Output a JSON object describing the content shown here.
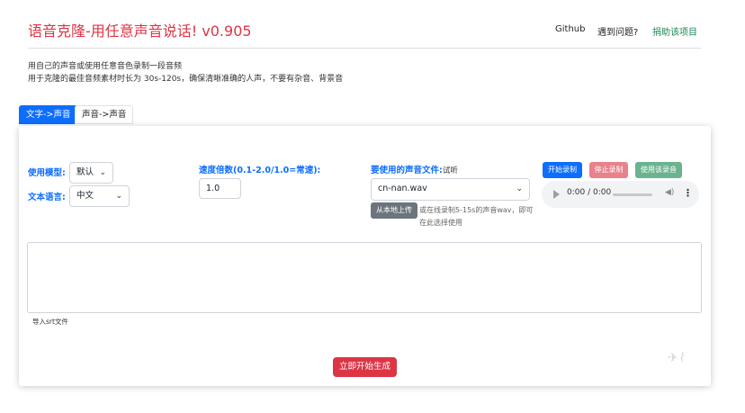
{
  "header": {
    "title": "语音克隆-用任意声音说话! v0.905",
    "nav": {
      "github": "Github",
      "problem": "遇到问题?",
      "donate": "捐助该项目"
    }
  },
  "intro": {
    "line1": "用自己的声音或使用任意音色录制一段音频",
    "line2": "用于克隆的最佳音频素材时长为 30s-120s，确保清晰准确的人声，不要有杂音、背景音"
  },
  "tabs": [
    {
      "label": "文字->声音",
      "active": true
    },
    {
      "label": "声音->声音",
      "active": false
    }
  ],
  "form": {
    "model_label": "使用模型:",
    "model_value": "默认",
    "lang_label": "文本语言:",
    "lang_value": "中文",
    "speed_label": "速度倍数(0.1-2.0/1.0=常速):",
    "speed_value": "1.0",
    "voice_label": "要使用的声音文件:",
    "voice_sub": "试听",
    "voice_value": "cn-nan.wav",
    "upload_label": "从本地上传",
    "upload_hint": "或在线录制5-15s的声音wav，即可在此选择使用",
    "record_start": "开始录制",
    "record_stop": "停止录制",
    "record_use": "使用该录音",
    "audio_time": "0:00 / 0:00",
    "srt_label": "导入srt文件",
    "generate": "立即开始生成"
  },
  "colors": {
    "accent": "#0d6efd",
    "title": "#dc3545",
    "generate": "#dc3545"
  }
}
